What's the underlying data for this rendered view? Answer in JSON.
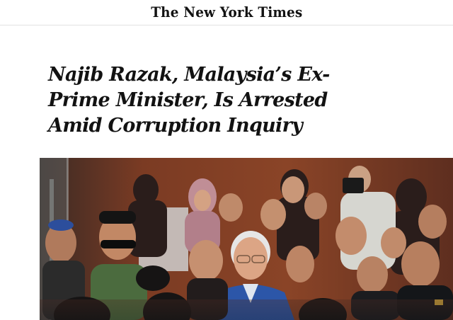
{
  "masthead": {
    "logo_text": "The New York Times"
  },
  "article": {
    "headline_lines": [
      "Najib Razak, Malaysia’s Ex-",
      "Prime Minister, Is Arrested",
      "Amid Corruption Inquiry"
    ]
  },
  "photo": {
    "icon": "news-photo",
    "dominant_colors": {
      "background": "#7a3a22",
      "suit": "#2c56a8",
      "skin": "#d9a27d"
    }
  }
}
